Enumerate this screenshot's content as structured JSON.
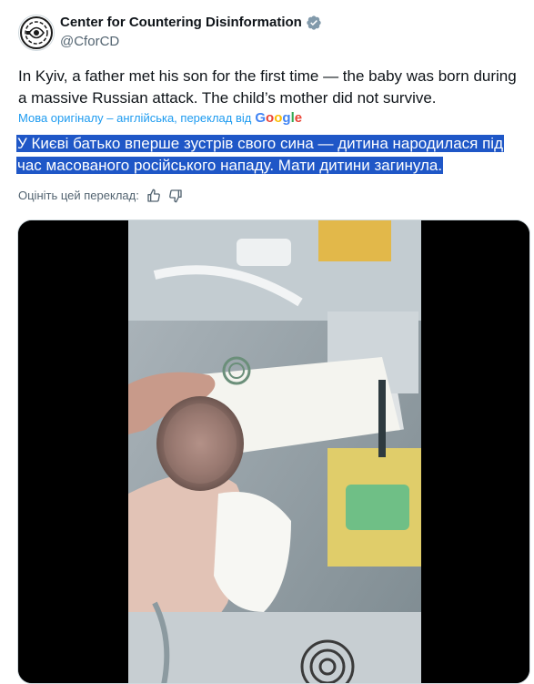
{
  "author": {
    "name": "Center for Countering Disinformation",
    "handle": "@CforCD",
    "avatar_icon": "ccd-logo-icon",
    "verified_icon": "verified-badge-icon"
  },
  "tweet": {
    "text": "In Kyiv, a father met his son for the first time — the baby was born during a massive Russian attack. The child’s mother did not survive."
  },
  "translation": {
    "note": "Мова оригіналу – англійська, переклад від",
    "provider": "Google",
    "text": "У Києві батько вперше зустрів свого сина — дитина народилася під час масованого російського нападу. Мати дитини загинула.",
    "rate_label": "Оцініть цей переклад:",
    "thumbs_up_icon": "thumbs-up-icon",
    "thumbs_down_icon": "thumbs-down-icon"
  },
  "media": {
    "type": "video",
    "description_icon": "newborn-baby-incubator-video-still"
  },
  "colors": {
    "link_blue": "#1d9bf0",
    "highlight_blue": "#1f57c7",
    "verified_gray": "#829aab",
    "secondary_text": "#536471"
  }
}
